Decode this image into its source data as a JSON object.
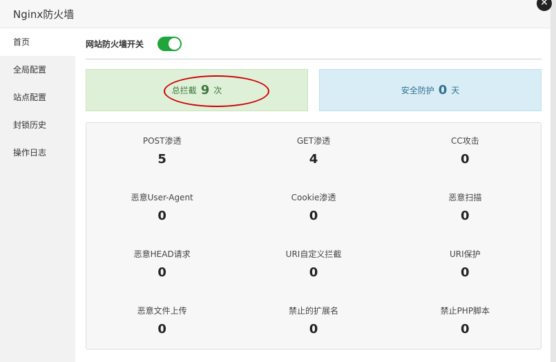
{
  "window": {
    "title": "Nginx防火墙",
    "close_glyph": "✕"
  },
  "sidebar": {
    "items": [
      {
        "label": "首页",
        "active": true
      },
      {
        "label": "全局配置",
        "active": false
      },
      {
        "label": "站点配置",
        "active": false
      },
      {
        "label": "封锁历史",
        "active": false
      },
      {
        "label": "操作日志",
        "active": false
      }
    ]
  },
  "firewall_switch": {
    "label": "网站防火墙开关",
    "enabled": true,
    "color": "#20a53a"
  },
  "summary": {
    "total_block": {
      "prefix": "总拦截",
      "value": "9",
      "suffix": "次"
    },
    "safe_days": {
      "prefix": "安全防护",
      "value": "0",
      "suffix": "天"
    }
  },
  "stats": [
    {
      "label": "POST渗透",
      "value": "5"
    },
    {
      "label": "GET渗透",
      "value": "4"
    },
    {
      "label": "CC攻击",
      "value": "0"
    },
    {
      "label": "恶意User-Agent",
      "value": "0"
    },
    {
      "label": "Cookie渗透",
      "value": "0"
    },
    {
      "label": "恶意扫描",
      "value": "0"
    },
    {
      "label": "恶意HEAD请求",
      "value": "0"
    },
    {
      "label": "URI自定义拦截",
      "value": "0"
    },
    {
      "label": "URI保护",
      "value": "0"
    },
    {
      "label": "恶意文件上传",
      "value": "0"
    },
    {
      "label": "禁止的扩展名",
      "value": "0"
    },
    {
      "label": "禁止PHP脚本",
      "value": "0"
    }
  ]
}
